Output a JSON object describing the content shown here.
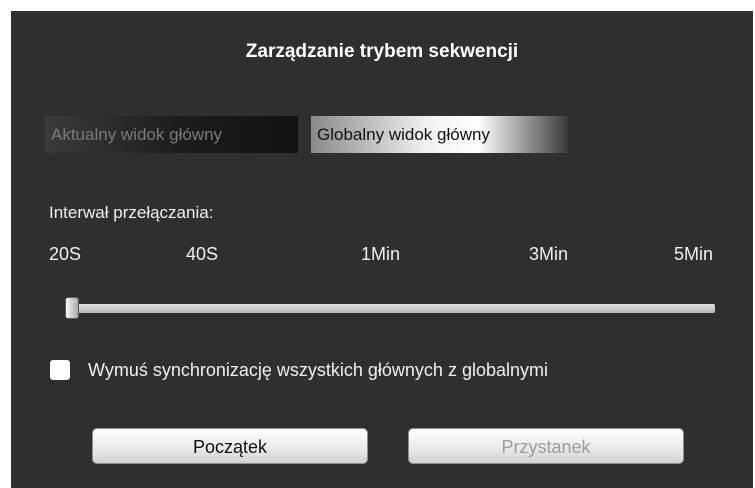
{
  "dialog": {
    "title": "Zarządzanie trybem sekwencji",
    "tabs": [
      {
        "label": "Aktualny widok główny",
        "selected": false
      },
      {
        "label": "Globalny widok główny",
        "selected": true
      }
    ],
    "interval": {
      "label": "Interwał przełączania:",
      "ticks": [
        "20S",
        "40S",
        "1Min",
        "3Min",
        "5Min"
      ],
      "selected_value": "20S"
    },
    "checkbox": {
      "label": "Wymuś synchronizację wszystkich głównych z globalnymi",
      "checked": false
    },
    "buttons": {
      "start_label": "Początek",
      "stop_label": "Przystanek",
      "stop_enabled": false
    }
  },
  "colors": {
    "dialog_bg": "#2f2f2f",
    "text": "#f0f0f0",
    "disabled_text": "#9c9c9c"
  }
}
